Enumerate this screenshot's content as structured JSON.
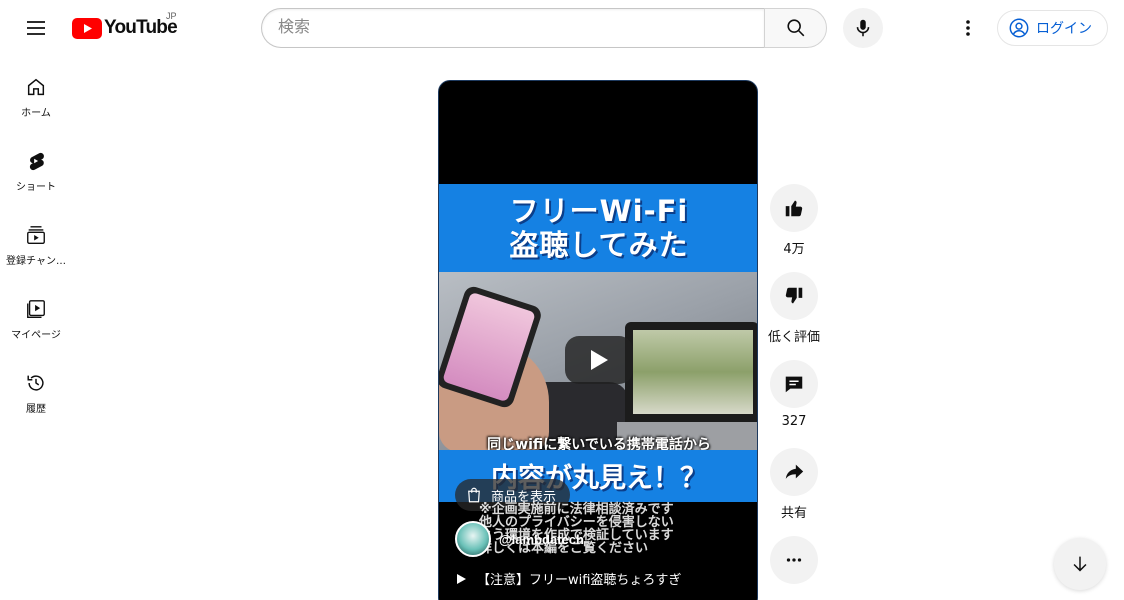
{
  "header": {
    "logo_text": "YouTube",
    "region": "JP",
    "search_placeholder": "検索",
    "login_label": "ログイン"
  },
  "sidebar": {
    "items": [
      {
        "label": "ホーム",
        "icon": "home-icon"
      },
      {
        "label": "ショート",
        "icon": "shorts-icon"
      },
      {
        "label": "登録チャン…",
        "icon": "subscriptions-icon"
      },
      {
        "label": "マイページ",
        "icon": "library-icon"
      },
      {
        "label": "履歴",
        "icon": "history-icon"
      }
    ]
  },
  "short": {
    "thumb_title_line1": "フリーWi-Fi",
    "thumb_title_line2": "盗聴してみた",
    "thumb_caption": "同じwifiに繋いでいる携帯電話から",
    "thumb_big_caption": "内容が丸見え！？",
    "product_label": "商品を表示",
    "description_lines": [
      "※企画実施前に法律相談済みです",
      "他人のプライバシーを侵害しない",
      "よう環境を作成で検証しています",
      "詳しくは本編をご覧ください"
    ],
    "channel_name": "@lambdatech",
    "video_title": "【注意】フリーwifi盗聴ちょろすぎ"
  },
  "actions": {
    "like_count": "4万",
    "dislike_label": "低く評価",
    "comment_count": "327",
    "share_label": "共有"
  },
  "colors": {
    "brand_red": "#ff0000",
    "link_blue": "#065fd4",
    "thumb_blue": "#1581e3"
  }
}
